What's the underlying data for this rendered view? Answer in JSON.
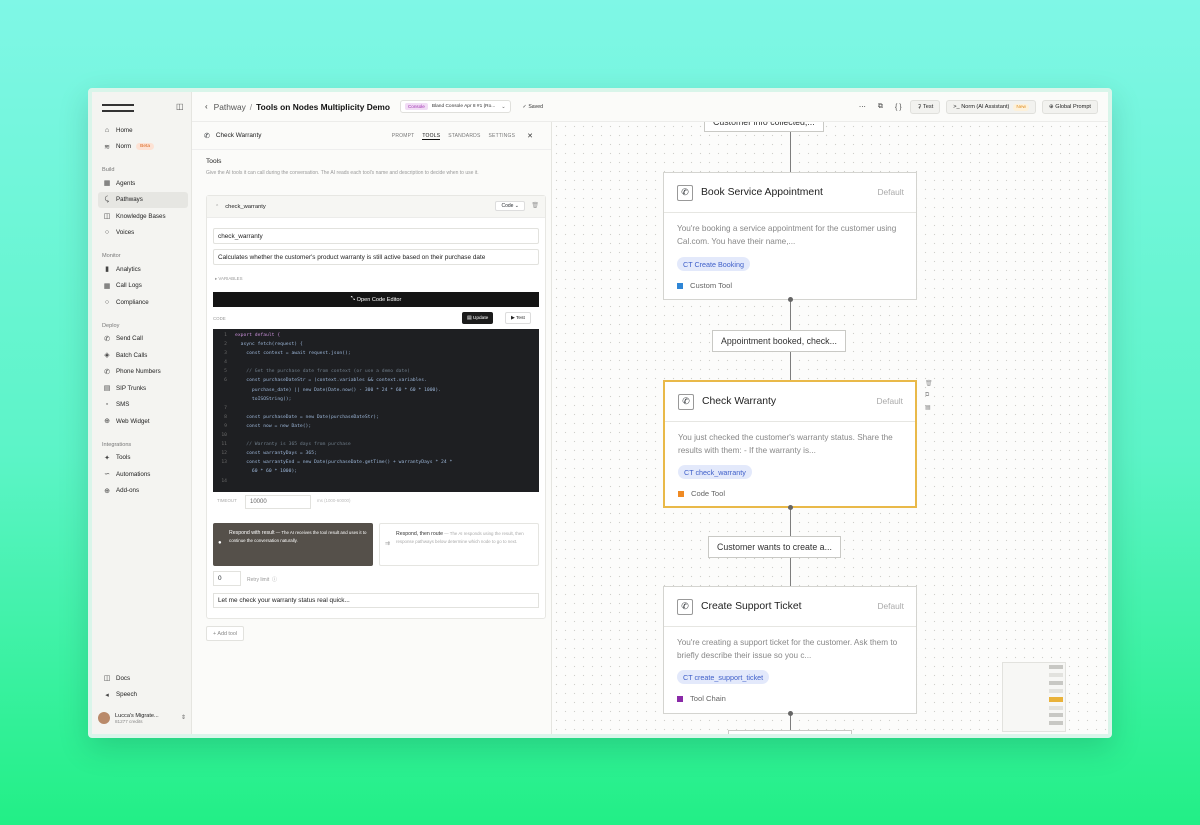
{
  "sidebar": {
    "home": "Home",
    "norm": "Norm",
    "norm_badge": "Beta",
    "sections": {
      "build": "Build",
      "monitor": "Monitor",
      "deploy": "Deploy",
      "integrations": "Integrations"
    },
    "build_items": [
      "Agents",
      "Pathways",
      "Knowledge Bases",
      "Voices"
    ],
    "monitor_items": [
      "Analytics",
      "Call Logs",
      "Compliance"
    ],
    "deploy_items": [
      "Send Call",
      "Batch Calls",
      "Phone Numbers",
      "SIP Trunks",
      "SMS",
      "Web Widget"
    ],
    "integration_items": [
      "Tools",
      "Automations",
      "Add-ons"
    ],
    "bottom_items": [
      "Docs",
      "Speech"
    ],
    "user_name": "Lucca's Migrate...",
    "user_credits": "81277 credits"
  },
  "header": {
    "crumb_parent": "Pathway",
    "crumb_title": "Tools on Nodes Multiplicity Demo",
    "console_badge": "Console",
    "console_text": "Bland Console Apr 8 #1 (Ro...",
    "saved": "Saved",
    "test_btn": "Test",
    "norm_btn": "Norm (AI Assistant)",
    "norm_new": "New",
    "global_prompt": "Global Prompt"
  },
  "panel": {
    "node_title": "Check Warranty",
    "tabs": [
      "PROMPT",
      "TOOLS",
      "STANDARDS",
      "SETTINGS"
    ],
    "tools_heading": "Tools",
    "tools_desc": "Give the AI tools it can call during the conversation. The AI reads each tool's name and description to decide when to use it.",
    "tool_name": "check_warranty",
    "tool_type": "Code",
    "name_value": "check_warranty",
    "desc_value": "Calculates whether the customer's product warranty is still active based on their purchase date",
    "variables": "▸ VARIABLES",
    "open_editor": "Open Code Editor",
    "code_label": "CODE",
    "update_btn": "Update",
    "test_btn": "Test",
    "code_lines": [
      {
        "n": "1",
        "t": "export default {"
      },
      {
        "n": "2",
        "t": "  async fetch(request) {"
      },
      {
        "n": "3",
        "t": "    const context = await request.json();"
      },
      {
        "n": "4",
        "t": ""
      },
      {
        "n": "5",
        "t": "    // Get the purchase date from context (or use a demo date)"
      },
      {
        "n": "6",
        "t": "    const purchaseDateStr = (context.variables && context.variables."
      },
      {
        "n": "",
        "t": "      purchase_date) || new Date(Date.now() - 300 * 24 * 60 * 60 * 1000)."
      },
      {
        "n": "",
        "t": "      toISOString();"
      },
      {
        "n": "7",
        "t": ""
      },
      {
        "n": "8",
        "t": "    const purchaseDate = new Date(purchaseDateStr);"
      },
      {
        "n": "9",
        "t": "    const now = new Date();"
      },
      {
        "n": "10",
        "t": ""
      },
      {
        "n": "11",
        "t": "    // Warranty is 365 days from purchase"
      },
      {
        "n": "12",
        "t": "    const warrantyDays = 365;"
      },
      {
        "n": "13",
        "t": "    const warrantyEnd = new Date(purchaseDate.getTime() + warrantyDays * 24 *"
      },
      {
        "n": "",
        "t": "      60 * 60 * 1000);"
      },
      {
        "n": "14",
        "t": ""
      }
    ],
    "timeout_label": "TIMEOUT",
    "timeout_value": "10000",
    "timeout_unit": "ms (1000-60000)",
    "respond_title": "Respond with result",
    "respond_desc": "— The AI receives the tool result and uses it to continue the conversation naturally.",
    "route_title": "Respond, then route",
    "route_desc": "— The AI responds using the result, then response pathways below determine which node to go to next.",
    "retry_value": "0",
    "retry_label": "Retry limit",
    "speech_value": "Let me check your warranty status real quick...",
    "add_tool": "+ Add tool"
  },
  "canvas": {
    "top_edge": "Customer info collected,...",
    "nodes": [
      {
        "title": "Book Service Appointment",
        "badge": "Default",
        "desc": "You're booking a service appointment for the customer using Cal.com. You have their name,...",
        "tag": "CT Create Booking",
        "type": "Custom Tool",
        "type_color": "#2f86d6"
      },
      {
        "title": "Check Warranty",
        "badge": "Default",
        "desc": "You just checked the customer's warranty status. Share the results with them: - If the warranty is...",
        "tag": "CT check_warranty",
        "type": "Code Tool",
        "type_color": "#ef8a24"
      },
      {
        "title": "Create Support Ticket",
        "badge": "Default",
        "desc": "You're creating a support ticket for the customer. Ask them to briefly describe their issue so you c...",
        "tag": "CT create_support_ticket",
        "type": "Tool Chain",
        "type_color": "#8a2aa8"
      }
    ],
    "edges": [
      "Appointment booked, check...",
      "Customer wants to create a..."
    ]
  }
}
